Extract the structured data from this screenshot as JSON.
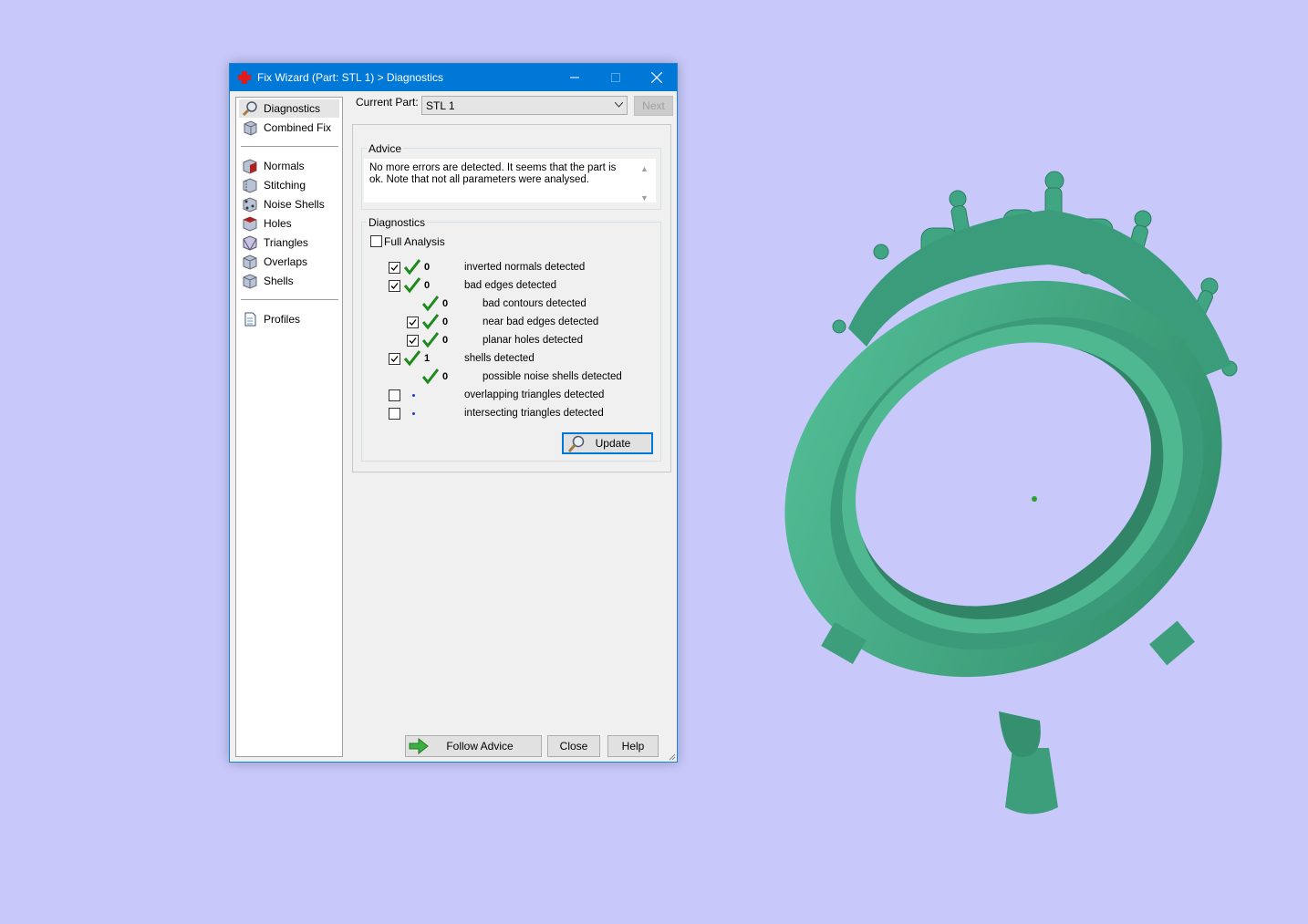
{
  "window": {
    "title": "Fix Wizard (Part: STL 1) > Diagnostics"
  },
  "sidebar": {
    "items": [
      {
        "label": "Diagnostics",
        "icon": "magnifier-icon",
        "selected": true
      },
      {
        "label": "Combined Fix",
        "icon": "cube-icon"
      },
      {
        "label": "Normals",
        "icon": "normals-cube-icon"
      },
      {
        "label": "Stitching",
        "icon": "stitching-cube-icon"
      },
      {
        "label": "Noise Shells",
        "icon": "noise-shells-cube-icon"
      },
      {
        "label": "Holes",
        "icon": "holes-cube-icon"
      },
      {
        "label": "Triangles",
        "icon": "triangles-cube-icon"
      },
      {
        "label": "Overlaps",
        "icon": "overlaps-cube-icon"
      },
      {
        "label": "Shells",
        "icon": "shells-cube-icon"
      },
      {
        "label": "Profiles",
        "icon": "document-icon"
      }
    ]
  },
  "current_part": {
    "label": "Current Part:",
    "value": "STL 1",
    "next_label": "Next"
  },
  "advice": {
    "title": "Advice",
    "text": "No more errors are detected. It seems that the part is ok. Note that not all parameters were analysed."
  },
  "diagnostics": {
    "title": "Diagnostics",
    "full_analysis_label": "Full Analysis",
    "full_analysis_checked": false,
    "rows": [
      {
        "checkbox": true,
        "checked": true,
        "status": "ok",
        "count": "0",
        "label": "inverted normals detected"
      },
      {
        "checkbox": true,
        "checked": true,
        "status": "ok",
        "count": "0",
        "label": "bad edges detected"
      },
      {
        "checkbox": false,
        "checked": false,
        "status": "ok",
        "count": "0",
        "label": "bad contours detected"
      },
      {
        "checkbox": true,
        "checked": true,
        "status": "ok",
        "count": "0",
        "label": "near bad edges detected"
      },
      {
        "checkbox": true,
        "checked": true,
        "status": "ok",
        "count": "0",
        "label": "planar holes detected"
      },
      {
        "checkbox": true,
        "checked": true,
        "status": "ok",
        "count": "1",
        "label": "shells detected"
      },
      {
        "checkbox": false,
        "checked": false,
        "status": "ok",
        "count": "0",
        "label": "possible noise shells detected"
      },
      {
        "checkbox": true,
        "checked": false,
        "status": "not-analysed",
        "count": "",
        "label": "overlapping triangles detected"
      },
      {
        "checkbox": true,
        "checked": false,
        "status": "not-analysed",
        "count": "",
        "label": "intersecting triangles detected"
      }
    ],
    "update_label": "Update"
  },
  "footer": {
    "follow_advice_label": "Follow Advice",
    "close_label": "Close",
    "help_label": "Help"
  },
  "colors": {
    "background": "#c8c8fa",
    "model": "#44a886",
    "titlebar": "#0078d7",
    "check": "#1d8a1d"
  }
}
